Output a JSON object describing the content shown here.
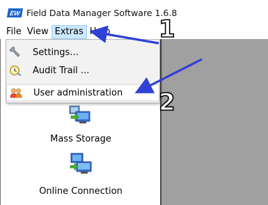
{
  "window": {
    "logo_text": "EW",
    "title": "Field Data Manager Software 1.6.8"
  },
  "menubar": {
    "items": [
      "File",
      "View",
      "Extras",
      "Help"
    ]
  },
  "extras_menu": {
    "items": [
      {
        "label": "Settings...",
        "icon": "wrench-icon"
      },
      {
        "label": "Audit Trail ...",
        "icon": "clock-icon"
      },
      {
        "label": "User administration",
        "icon": "users-icon"
      }
    ]
  },
  "panel": {
    "items": [
      {
        "label": "Mass Storage",
        "icon": "mass-storage-icon"
      },
      {
        "label": "Online Connection",
        "icon": "online-connection-icon"
      }
    ]
  },
  "annotations": {
    "step1": "1",
    "step2": "2",
    "arrow_color": "#2f41d6"
  }
}
